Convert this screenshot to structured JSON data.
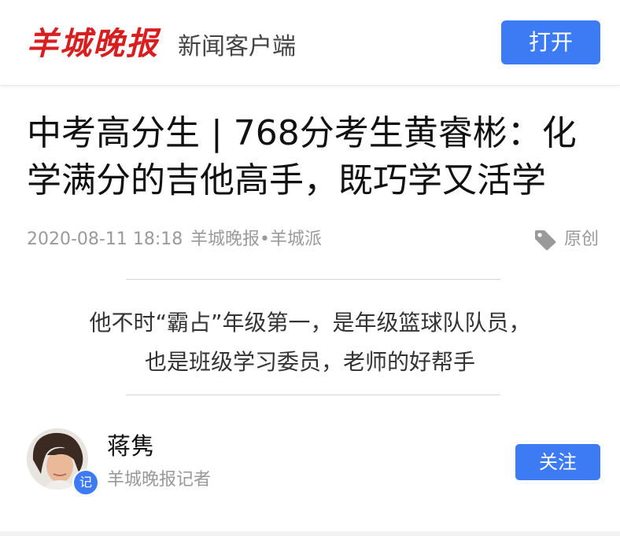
{
  "header": {
    "logo_text": "羊城晚报",
    "client_label": "新闻客户端",
    "open_button": "打开",
    "logo_color": "#d81e1e",
    "accent_color": "#3d7bf5"
  },
  "article": {
    "title": "中考高分生 | 768分考生黄睿彬：化学满分的吉他高手，既巧学又活学",
    "date": "2020-08-11 18:18",
    "source": "羊城晚报•羊城派",
    "tag_icon": "tag-icon",
    "tag_label": "原创",
    "summary_line1": "他不时“霸占”年级第一，是年级篮球队队员，",
    "summary_line2": "也是班级学习委员，老师的好帮手"
  },
  "author": {
    "name": "蒋隽",
    "role": "羊城晚报记者",
    "badge": "记",
    "follow_button": "关注"
  }
}
